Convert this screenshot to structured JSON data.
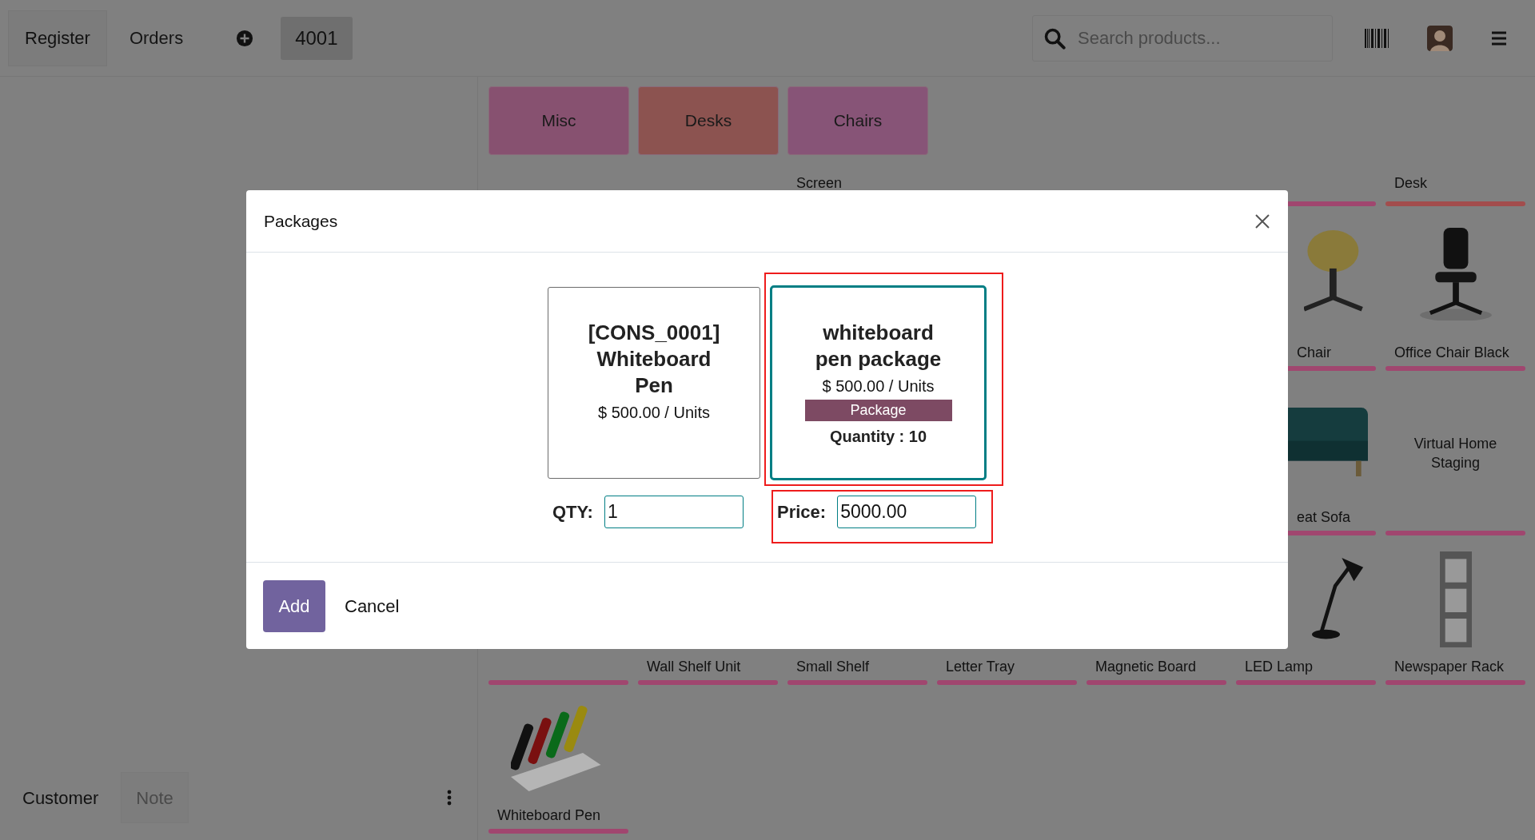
{
  "topbar": {
    "tabs": [
      {
        "label": "Register",
        "selected": true
      },
      {
        "label": "Orders",
        "selected": false
      }
    ],
    "orders": [
      {
        "label": "4001",
        "selected": true
      }
    ],
    "search": {
      "placeholder": "Search products..."
    }
  },
  "categories": [
    {
      "label": "Misc",
      "color": "#875170"
    },
    {
      "label": "Desks",
      "color": "#8c5350"
    },
    {
      "label": "Chairs",
      "color": "#875477"
    }
  ],
  "product_rows": [
    {
      "cells": [
        {},
        {},
        {
          "name": "Screen"
        },
        {},
        {},
        {
          "color": "#a0466f"
        },
        {
          "name": "Desk",
          "color": "#a24d4d"
        }
      ]
    },
    {
      "cells": [
        {},
        {},
        {},
        {},
        {},
        {
          "name": "Chair",
          "kind": "picture",
          "color": "#a0466f"
        },
        {
          "name": "Office Chair Black",
          "kind": "picture",
          "color": "#a0466f"
        }
      ]
    },
    {
      "cells": [
        {},
        {},
        {},
        {},
        {},
        {
          "name": "eat Sofa",
          "kind": "picture",
          "color": "#a0466f"
        },
        {
          "name": "Virtual Home Staging",
          "kind": "plain",
          "color": "#a0466f"
        }
      ]
    },
    {
      "cells": [
        {
          "color": "#a0466f"
        },
        {
          "name": "Wall Shelf Unit",
          "color": "#a0466f"
        },
        {
          "name": "Small Shelf",
          "color": "#a0466f"
        },
        {
          "name": "Letter Tray",
          "color": "#a0466f"
        },
        {
          "name": "Magnetic Board",
          "color": "#a0466f"
        },
        {
          "name": "LED Lamp",
          "kind": "picture",
          "color": "#a0466f"
        },
        {
          "name": "Newspaper Rack",
          "kind": "picture",
          "color": "#a0466f"
        }
      ]
    },
    {
      "cells": [
        {
          "name": "Whiteboard Pen",
          "kind": "picture",
          "color": "#a0466f"
        }
      ]
    }
  ],
  "order_panel": {
    "buttons": [
      {
        "label": "Customer",
        "kind": "plain"
      },
      {
        "label": "Note",
        "kind": "boxed"
      }
    ]
  },
  "dialog": {
    "title": "Packages",
    "options": [
      {
        "name": "[CONS_0001] Whiteboard Pen",
        "price": "$ 500.00 / Units",
        "selected": false,
        "highlighted": false
      },
      {
        "name": "whiteboard pen package",
        "price": "$ 500.00 / Units",
        "badge": "Package",
        "quantity": "Quantity : 10",
        "selected": true,
        "highlighted": true
      }
    ],
    "fields": [
      {
        "label": "QTY:",
        "value": "1",
        "highlighted": false
      },
      {
        "label": "Price:",
        "value": "5000.00",
        "highlighted": true
      }
    ],
    "buttons": [
      {
        "label": "Add",
        "kind": "primary"
      },
      {
        "label": "Cancel",
        "kind": "secondary"
      }
    ]
  }
}
